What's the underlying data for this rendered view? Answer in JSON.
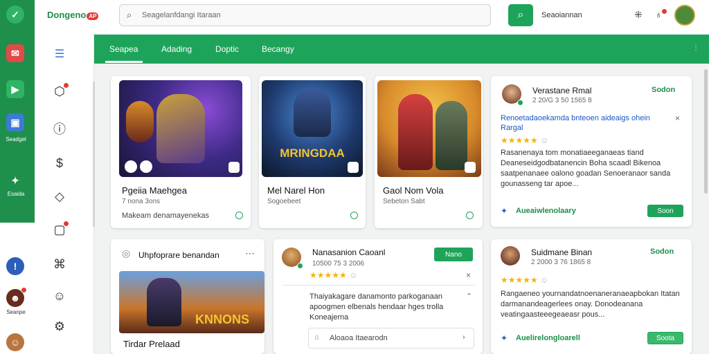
{
  "app": {
    "logo_text": "Dongeno",
    "logo_badge": "AP"
  },
  "rail": {
    "items": [
      {
        "label": ""
      },
      {
        "label": ""
      },
      {
        "label": ""
      },
      {
        "label": "Seadgel"
      },
      {
        "label": "Esaida"
      },
      {
        "label": ""
      },
      {
        "label": "Seanpe"
      },
      {
        "label": ""
      }
    ]
  },
  "header": {
    "search_placeholder": "Seagelanfdangi Itaraan",
    "right_label": "Seaoiannan"
  },
  "tabs": [
    {
      "label": "Seapea"
    },
    {
      "label": "Adading"
    },
    {
      "label": "Doptic"
    },
    {
      "label": "Becangy"
    }
  ],
  "games": [
    {
      "title": "Pgeiia Maehgea",
      "meta": "7 nona 3ons",
      "desc": "Makeam denamayenekas",
      "art_text": ""
    },
    {
      "title": "Mel Narel Hon",
      "meta": "Sogoebeet",
      "desc": "",
      "art_text": "MRINGDAA"
    },
    {
      "title": "Gaol Nom Vola",
      "meta": "Sebeton Sabt",
      "desc": "",
      "art_text": ""
    }
  ],
  "reviews": [
    {
      "name": "Verastane Rmal",
      "date": "2 20/G 3 50 1565 8",
      "action": "Sodon",
      "headline": "Renoetadaoekamda bnteoen aideaigs ohein Rargal",
      "text": "Rasanenaya tom monatiaeeganaeas tiand Deaneseidgodbatanencin Boha scaadl Bikenoa saatpenanaee oalono goadan Senoeranaor sanda gounasseng tar apoe...",
      "footer": "Aueaiwlenolaary",
      "button": "Soon"
    },
    {
      "name": "Nanasanion Caoanl",
      "date": "10500 75 3 2006",
      "action": "Nano",
      "headline": "",
      "text": "Thaiyakagare danamonto parkoganaan apoogmen elbenals hendaar hges trolla Koneajerna",
      "footer": "Aloaoa Itaearodn",
      "button": ""
    },
    {
      "name": "Suidmane Binan",
      "date": "2 2000 3 76 1865 8",
      "action": "Sodon",
      "headline": "",
      "text": "Rangaeneo yournandatnoenaneranaeapbokan Itatan darmanandeagerlees onay. Donodeanana veatingaasteeegeaeasr pous...",
      "footer": "Auelirelongloarell",
      "button": "Soota"
    }
  ],
  "featured": {
    "title": "Uhpfoprare benandan",
    "art_text": "KNNONS",
    "footer": "Tirdar Prelaad"
  },
  "colors": {
    "brand_green": "#1ea45a",
    "rail_green": "#1f8f4c",
    "star": "#f4b400",
    "link_blue": "#1a56c5"
  }
}
